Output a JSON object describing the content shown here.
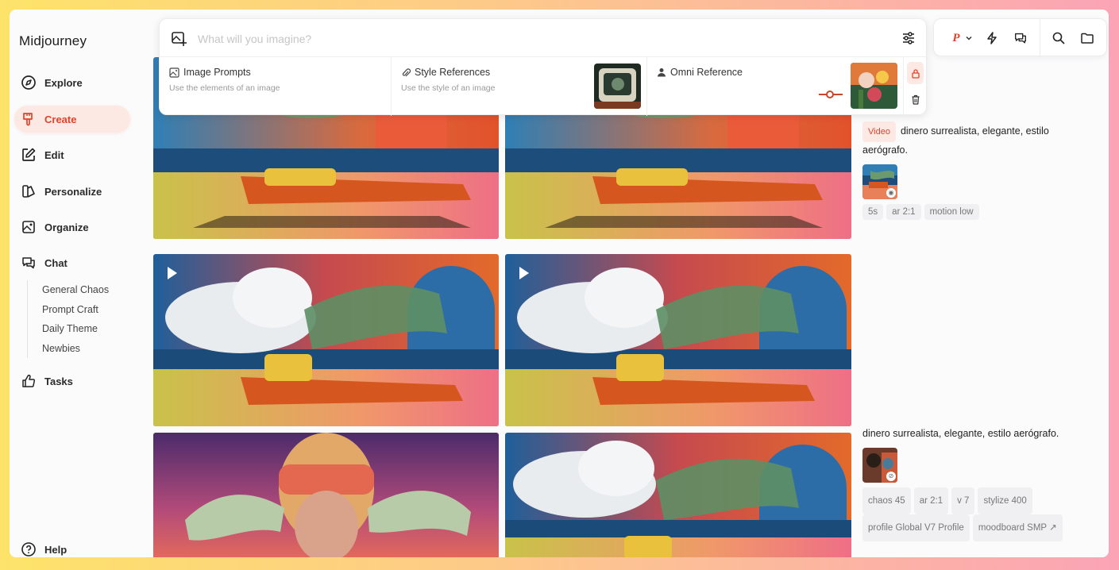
{
  "app": {
    "title": "Midjourney"
  },
  "sidebar": {
    "items": [
      {
        "label": "Explore"
      },
      {
        "label": "Create"
      },
      {
        "label": "Edit"
      },
      {
        "label": "Personalize"
      },
      {
        "label": "Organize"
      },
      {
        "label": "Chat"
      },
      {
        "label": "Tasks"
      },
      {
        "label": "Help"
      }
    ],
    "chat_channels": [
      "General Chaos",
      "Prompt Craft",
      "Daily Theme",
      "Newbies"
    ],
    "active_color": "#e0432a"
  },
  "prompt": {
    "placeholder": "What will you imagine?",
    "value": ""
  },
  "references": {
    "image_prompts": {
      "title": "Image Prompts",
      "subtitle": "Use the elements of an image"
    },
    "style_references": {
      "title": "Style References",
      "subtitle": "Use the style of an image"
    },
    "omni_reference": {
      "title": "Omni Reference"
    }
  },
  "toolbar": {
    "profile_letter": "P"
  },
  "jobs": [
    {
      "badge": "Video",
      "prompt": "dinero surrealista, elegante, estilo aerógrafo.",
      "params": [
        "5s",
        "ar 2:1",
        "motion low"
      ]
    },
    {
      "prompt": "dinero surrealista, elegante, estilo aerógrafo.",
      "params": [
        "chaos 45",
        "ar 2:1",
        "v 7",
        "stylize 400",
        "profile Global V7 Profile",
        "moodboard SMP"
      ]
    }
  ]
}
